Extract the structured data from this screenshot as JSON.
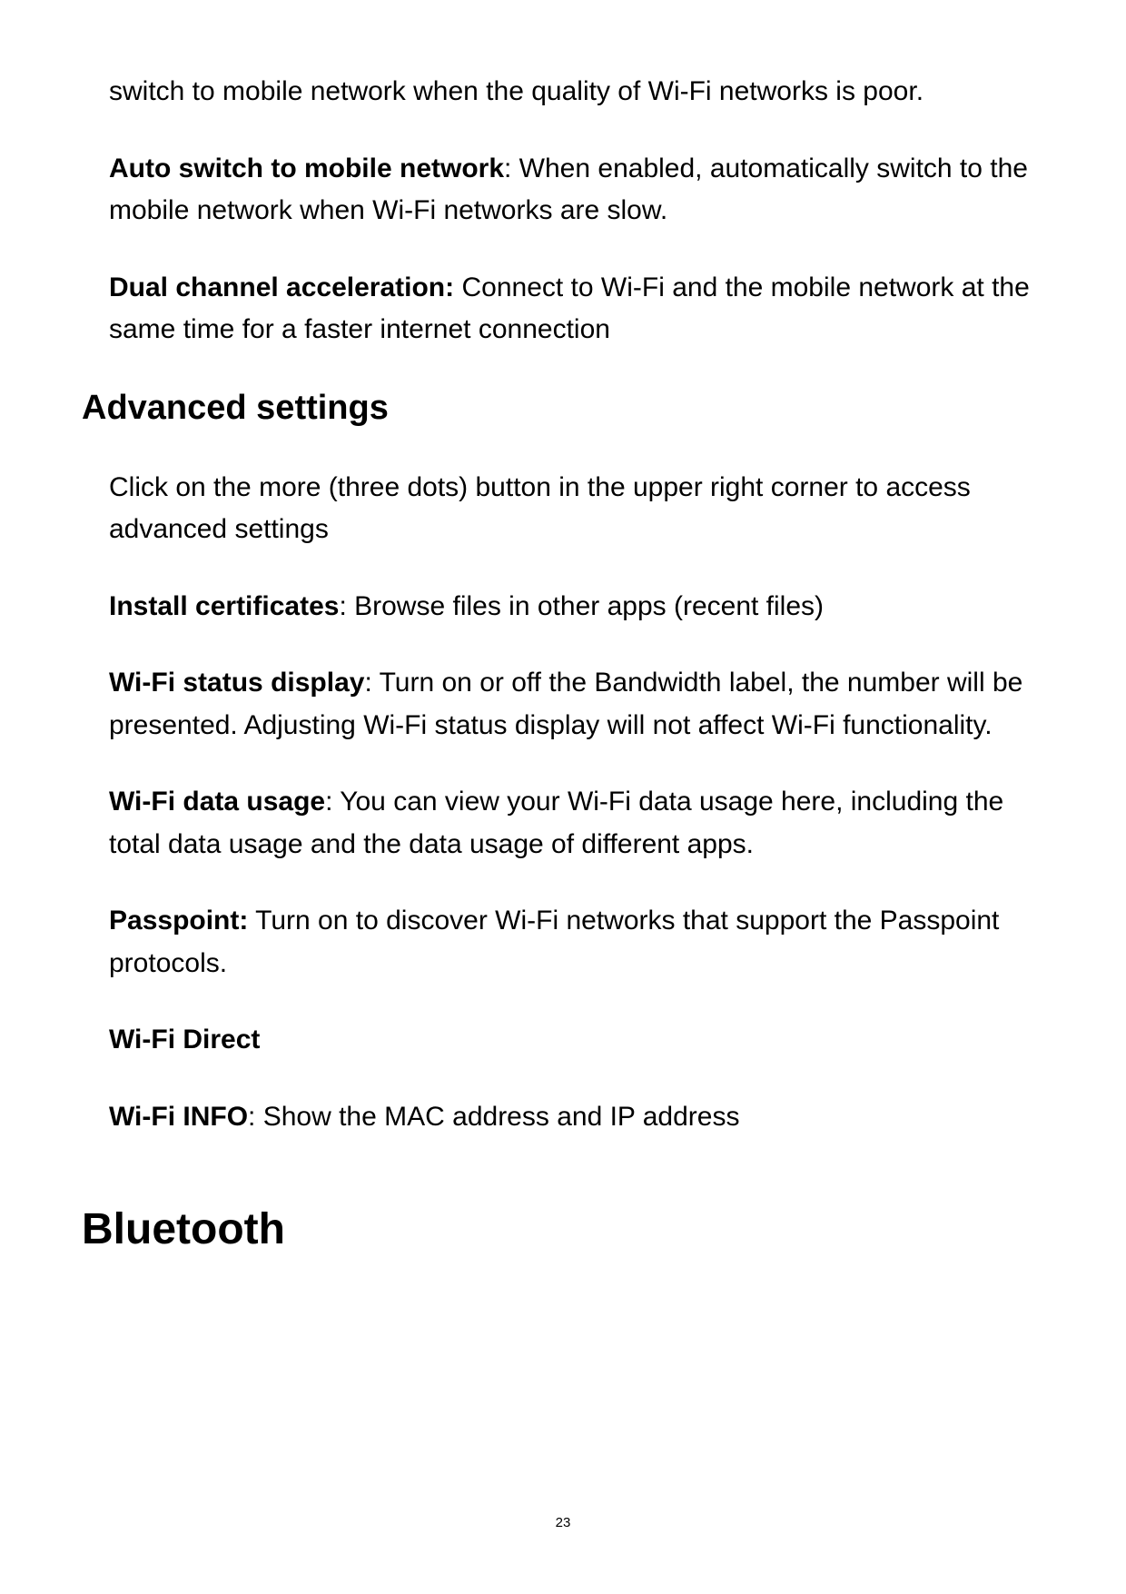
{
  "intro1": "switch to mobile network when the quality of Wi-Fi networks is poor.",
  "para_autoswitch_bold": "Auto switch to mobile network",
  "para_autoswitch_rest": ": When enabled, automatically switch to the mobile network when Wi-Fi networks are slow.",
  "para_dual_bold": "Dual channel acceleration:",
  "para_dual_rest": " Connect to Wi-Fi and the mobile network at the same time for a faster internet connection",
  "h2_advanced": "Advanced settings",
  "adv_intro": "Click on the more (three dots) button in the upper right corner to access advanced settings",
  "install_bold": "Install certificates",
  "install_rest": ": Browse files in other apps (recent files)",
  "status_bold": "Wi-Fi status display",
  "status_rest": ": Turn on or off the Bandwidth label, the number will be presented. Adjusting Wi-Fi status display will not affect Wi-Fi functionality.",
  "usage_bold": "Wi-Fi data usage",
  "usage_rest": ": You can view your Wi-Fi data usage here, including the total data usage and the data usage of different apps.",
  "passpoint_bold": "Passpoint:",
  "passpoint_rest": " Turn on to discover Wi-Fi networks that support the Passpoint protocols.",
  "wifi_direct": "Wi-Fi Direct",
  "wifi_info_bold": "Wi-Fi INFO",
  "wifi_info_rest": ": Show the MAC address and IP address",
  "h1_bluetooth": "Bluetooth",
  "page_number": "23"
}
